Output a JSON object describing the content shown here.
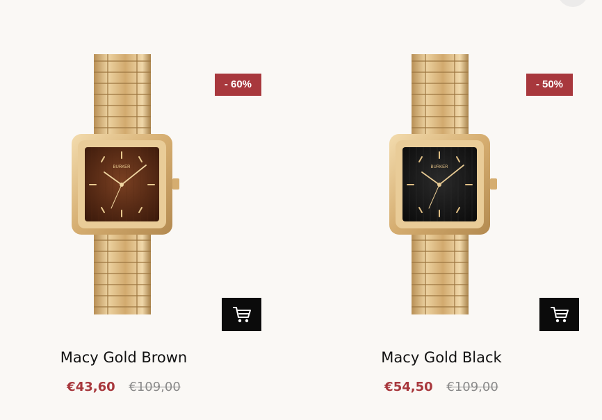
{
  "products": [
    {
      "name": "Macy Gold Brown",
      "badge": "- 60%",
      "sale_price": "€43,60",
      "original_price": "€109,00",
      "brand_mark": "BURKER",
      "dial_color": "#4a2412",
      "case_color": "#d8b176"
    },
    {
      "name": "Macy Gold Black",
      "badge": "- 50%",
      "sale_price": "€54,50",
      "original_price": "€109,00",
      "brand_mark": "BURKER",
      "dial_color": "#151515",
      "case_color": "#d8b176"
    }
  ],
  "icons": {
    "cart": "cart-icon"
  },
  "colors": {
    "badge": "#a8383d",
    "sale_price": "#a8383d",
    "old_price": "#8a8a8a",
    "cart_button": "#0b0b0b",
    "background": "#faf8f5"
  }
}
